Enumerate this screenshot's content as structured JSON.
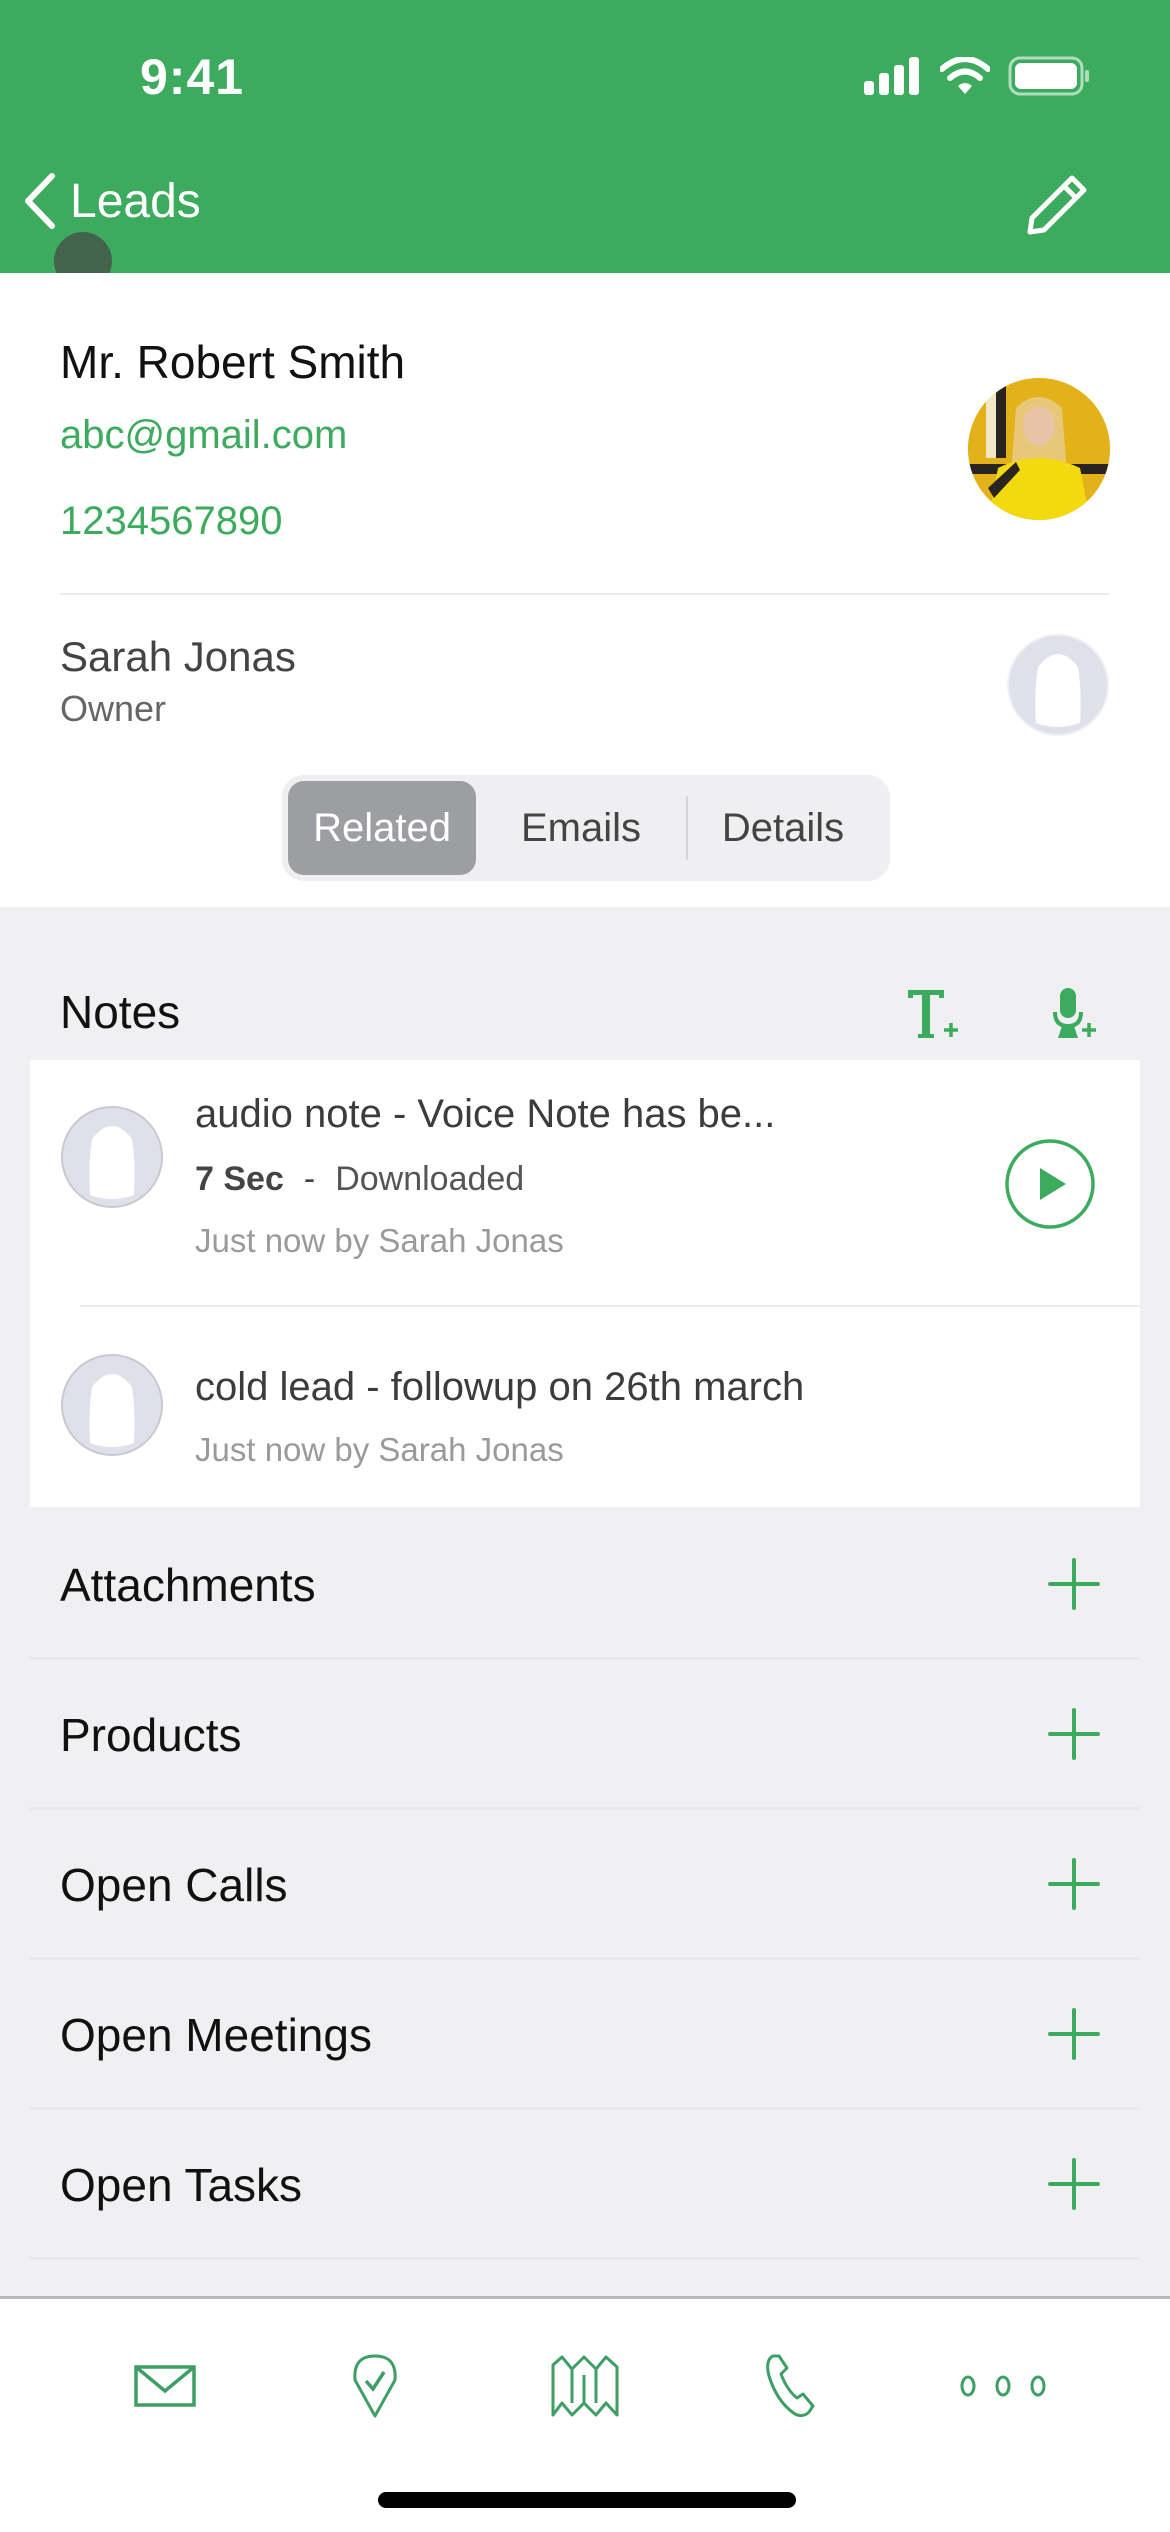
{
  "status_bar": {
    "time": "9:41"
  },
  "nav": {
    "back_label": "Leads",
    "edit_icon": "pencil-icon"
  },
  "lead": {
    "name": "Mr. Robert Smith",
    "email": "abc@gmail.com",
    "phone": "1234567890"
  },
  "owner": {
    "name": "Sarah Jonas",
    "role": "Owner"
  },
  "segments": [
    {
      "label": "Related",
      "active": true
    },
    {
      "label": "Emails",
      "active": false
    },
    {
      "label": "Details",
      "active": false
    }
  ],
  "notes": {
    "title": "Notes",
    "items": [
      {
        "title": "audio note - Voice Note has be...",
        "duration": "7 Sec",
        "separator": "-",
        "status": "Downloaded",
        "byline": "Just now by Sarah Jonas"
      },
      {
        "title": "cold lead - followup on 26th march",
        "byline": "Just now by Sarah Jonas"
      }
    ]
  },
  "sections": [
    {
      "label": "Attachments"
    },
    {
      "label": "Products"
    },
    {
      "label": "Open Calls"
    },
    {
      "label": "Open Meetings"
    },
    {
      "label": "Open Tasks"
    }
  ],
  "tabbar": [
    "mail-icon",
    "location-check-icon",
    "map-icon",
    "phone-icon",
    "more-icon"
  ],
  "colors": {
    "brand": "#3dab5e",
    "background": "#f0eff2"
  }
}
